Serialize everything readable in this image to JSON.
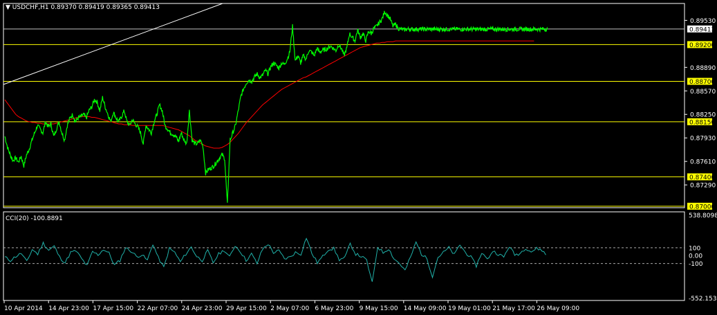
{
  "colors": {
    "background": "#000000",
    "frame": "#ffffff",
    "price": "#00ff00",
    "ma": "#ff0000",
    "level": "#ffff00",
    "level_label_bg": "#ffff00",
    "current_line": "#c0c0c0",
    "cci": "#20b2aa",
    "trendline": "#ffffff"
  },
  "main_panel": {
    "title": "USDCHF,H1  0.89370 0.89419 0.89365 0.89413"
  },
  "cci_panel": {
    "title": "CCI(20) -100.8891"
  },
  "chart_data": [
    {
      "type": "line",
      "symbol": "USDCHF",
      "timeframe": "H1",
      "ohlc_last": {
        "open": 0.8937,
        "high": 0.89419,
        "low": 0.89365,
        "close": 0.89413
      },
      "current_price": "0.89413",
      "y_ticks": [
        "0.89530",
        "0.88890",
        "0.88570",
        "0.88250",
        "0.87930",
        "0.87610",
        "0.87290"
      ],
      "ylim": [
        0.8698,
        0.8976
      ],
      "horizontal_levels": [
        "0.89200",
        "0.88700",
        "0.88150",
        "0.87400",
        "0.87000"
      ],
      "x_tick_labels": [
        "10 Apr 2014",
        "14 Apr 23:00",
        "17 Apr 15:00",
        "22 Apr 07:00",
        "24 Apr 23:00",
        "29 Apr 15:00",
        "2 May 07:00",
        "6 May 23:00",
        "9 May 15:00",
        "14 May 09:00",
        "19 May 01:00",
        "21 May 17:00",
        "26 May 09:00"
      ],
      "series": [
        {
          "x": [
            0,
            0.5,
            1,
            1.5,
            2,
            2.5,
            3,
            3.5,
            4,
            4.5,
            5,
            5.5,
            6,
            6.5,
            7,
            7.5,
            8,
            8.5,
            9,
            9.5,
            10,
            10.5,
            11,
            11.5,
            12,
            12.5,
            13,
            13.5,
            14,
            14.5,
            15,
            15.5,
            16,
            16.5,
            17,
            17.5,
            18,
            18.5,
            19,
            19.5,
            20,
            20.5,
            21,
            21.5,
            22,
            22.5,
            23,
            23.5,
            24,
            24.5,
            25,
            25.5,
            26,
            26.5,
            27,
            27.5,
            28,
            28.5,
            29,
            29.5,
            30,
            30.5,
            31,
            31.5,
            32,
            32.5,
            33,
            33.5,
            34,
            34.5,
            35,
            35.5,
            36,
            36.5,
            37,
            37.5,
            38,
            38.5,
            39,
            39.5,
            40,
            40.5,
            41,
            41.5,
            42,
            42.5,
            43,
            43.5,
            44,
            44.5,
            45,
            45.5,
            46,
            46.5,
            47,
            47.5,
            48,
            48.5,
            49,
            49.5,
            50,
            50.5,
            51,
            51.5,
            52,
            52.5,
            53,
            53.5,
            54,
            54.5,
            55,
            55.5,
            56,
            56.5,
            57,
            57.5,
            58,
            58.5,
            59,
            59.5,
            60,
            60.5,
            61,
            61.5,
            62,
            62.5,
            63,
            63.5,
            64,
            64.5,
            65,
            65.5,
            66,
            66.5,
            67,
            67.5,
            68,
            68.5,
            69,
            69.5,
            70,
            70.5,
            71,
            71.5,
            72,
            72.5,
            73,
            73.5,
            74,
            74.5,
            75,
            75.5,
            76,
            76.5,
            77,
            77.5,
            78,
            78.5,
            79,
            79.5,
            80,
            80.5,
            81,
            81.5,
            82,
            82.5,
            83,
            83.5,
            84,
            84.5,
            85,
            85.5,
            86,
            86.5,
            87,
            87.5,
            88,
            88.5,
            89,
            89.5,
            90,
            90.5,
            91,
            91.5,
            92,
            92.5,
            93,
            93.5,
            94,
            94.5,
            95,
            95.5,
            96,
            96.5,
            97,
            97.5,
            98,
            98.5,
            99,
            99.5,
            100
          ],
          "name": "",
          "values": [
            0.8795,
            0.878,
            0.877,
            0.8762,
            0.8766,
            0.876,
            0.8768,
            0.8755,
            0.877,
            0.8778,
            0.879,
            0.88,
            0.881,
            0.8805,
            0.88,
            0.8815,
            0.8808,
            0.8812,
            0.8795,
            0.8805,
            0.8815,
            0.88,
            0.879,
            0.881,
            0.882,
            0.8825,
            0.8815,
            0.882,
            0.8822,
            0.8825,
            0.882,
            0.883,
            0.8835,
            0.8845,
            0.8842,
            0.883,
            0.8848,
            0.8835,
            0.8825,
            0.8815,
            0.8828,
            0.882,
            0.8815,
            0.8822,
            0.883,
            0.8815,
            0.881,
            0.8818,
            0.8812,
            0.8808,
            0.88,
            0.8785,
            0.881,
            0.8805,
            0.88,
            0.8815,
            0.8825,
            0.8838,
            0.883,
            0.881,
            0.8805,
            0.88,
            0.8798,
            0.8795,
            0.8788,
            0.88,
            0.879,
            0.8785,
            0.883,
            0.879,
            0.8785,
            0.8785,
            0.879,
            0.8782,
            0.8745,
            0.875,
            0.8752,
            0.8755,
            0.876,
            0.8765,
            0.877,
            0.8765,
            0.8702,
            0.879,
            0.88,
            0.881,
            0.883,
            0.885,
            0.886,
            0.8868,
            0.8872,
            0.887,
            0.8876,
            0.888,
            0.8875,
            0.8878,
            0.8885,
            0.888,
            0.889,
            0.8895,
            0.8892,
            0.8888,
            0.8895,
            0.8893,
            0.89,
            0.891,
            0.8945,
            0.8898,
            0.8905,
            0.8895,
            0.8905,
            0.89,
            0.8912,
            0.891,
            0.8905,
            0.8915,
            0.891,
            0.8912,
            0.8913,
            0.8915,
            0.8918,
            0.8915,
            0.8912,
            0.892,
            0.8915,
            0.8905,
            0.8915,
            0.8935,
            0.893,
            0.8925,
            0.894,
            0.893,
            0.8935,
            0.8925,
            0.8938,
            0.8935,
            0.8942,
            0.8945,
            0.895,
            0.8955,
            0.8965,
            0.896,
            0.8955,
            0.8945,
            0.8948,
            0.8942,
            0.8941,
            0.894,
            0.8941,
            0.8941,
            0.8941,
            0.8941,
            0.8941,
            0.8941,
            0.8941,
            0.8941,
            0.8941,
            0.8941,
            0.8941,
            0.8941,
            0.8941,
            0.8941,
            0.8941,
            0.8941,
            0.8941,
            0.8941,
            0.8941,
            0.8941,
            0.8941,
            0.8941,
            0.8941,
            0.8941,
            0.8941,
            0.8941,
            0.8941,
            0.8941,
            0.8941,
            0.8941,
            0.8941,
            0.8941,
            0.8941,
            0.8941,
            0.8941,
            0.8941,
            0.8941,
            0.8941,
            0.8941,
            0.8941,
            0.8941,
            0.8941,
            0.8941,
            0.8941,
            0.8941,
            0.8941,
            0.8941,
            0.8941,
            0.8941,
            0.8941,
            0.8941,
            0.8941,
            0.8941
          ]
        },
        {
          "name": "",
          "ma_values": [
            0.8845,
            0.884,
            0.8835,
            0.883,
            0.8825,
            0.8822,
            0.882,
            0.8818,
            0.8816,
            0.8815,
            0.8814,
            0.8814,
            0.8813,
            0.8813,
            0.8812,
            0.8812,
            0.8812,
            0.8812,
            0.8812,
            0.8813,
            0.8814,
            0.8815,
            0.8816,
            0.8817,
            0.8818,
            0.8819,
            0.882,
            0.8821,
            0.8822,
            0.8822,
            0.8822,
            0.8822,
            0.8821,
            0.8821,
            0.882,
            0.8819,
            0.8818,
            0.8817,
            0.8816,
            0.8815,
            0.8814,
            0.8813,
            0.8812,
            0.8812,
            0.8811,
            0.8811,
            0.8811,
            0.881,
            0.881,
            0.881,
            0.881,
            0.881,
            0.881,
            0.881,
            0.881,
            0.881,
            0.881,
            0.881,
            0.881,
            0.8809,
            0.8808,
            0.8807,
            0.8806,
            0.8805,
            0.8804,
            0.8802,
            0.88,
            0.8798,
            0.8796,
            0.8793,
            0.879,
            0.8788,
            0.8786,
            0.8784,
            0.8782,
            0.8781,
            0.878,
            0.8779,
            0.8779,
            0.8779,
            0.878,
            0.8782,
            0.8784,
            0.8787,
            0.8791,
            0.8795,
            0.8799,
            0.8804,
            0.8809,
            0.8814,
            0.8818,
            0.8822,
            0.8826,
            0.883,
            0.8834,
            0.8838,
            0.8841,
            0.8844,
            0.8847,
            0.885,
            0.8853,
            0.8856,
            0.8859,
            0.8861,
            0.8863,
            0.8865,
            0.8867,
            0.8869,
            0.8871,
            0.8873,
            0.8875,
            0.8876,
            0.8878,
            0.888,
            0.8882,
            0.8884,
            0.8886,
            0.8888,
            0.889,
            0.8892,
            0.8894,
            0.8896,
            0.8898,
            0.89,
            0.8902,
            0.8904,
            0.8906,
            0.8908,
            0.891,
            0.8912,
            0.8914,
            0.8916,
            0.8917,
            0.8918,
            0.8919,
            0.892,
            0.8921,
            0.8922,
            0.8922,
            0.8923,
            0.8923,
            0.8924,
            0.8924,
            0.8924,
            0.8925,
            0.8925,
            0.8925,
            0.8925,
            0.8925,
            0.8925,
            0.8925,
            0.8925,
            0.8925,
            0.8925,
            0.8925,
            0.8925,
            0.8925,
            0.8925,
            0.8925,
            0.8925,
            0.8925,
            0.8925,
            0.8925,
            0.8925,
            0.8925,
            0.8925,
            0.8925,
            0.8925,
            0.8925,
            0.8925,
            0.8925,
            0.8925,
            0.8925,
            0.8925,
            0.8925,
            0.8925,
            0.8925,
            0.8925,
            0.8925,
            0.8925,
            0.8925,
            0.8925,
            0.8925,
            0.8925,
            0.8925,
            0.8925,
            0.8925,
            0.8925,
            0.8925,
            0.8925,
            0.8925,
            0.8925,
            0.8925,
            0.8925,
            0.8925,
            0.8925
          ]
        }
      ]
    },
    {
      "type": "line",
      "indicator": "CCI(20)",
      "current_value": "-100.8891",
      "y_ticks": [
        "538.8098",
        "100",
        "0.00",
        "-100",
        "-552.1533"
      ],
      "ylim": [
        -552.1533,
        538.8098
      ],
      "levels": [
        100,
        -100
      ],
      "series": [
        {
          "name": "",
          "values": [
            -20,
            -60,
            -10,
            30,
            -80,
            80,
            20,
            160,
            70,
            120,
            -20,
            -90,
            40,
            60,
            -40,
            -130,
            50,
            10,
            80,
            30,
            -120,
            -60,
            100,
            60,
            -10,
            10,
            -60,
            150,
            -30,
            -150,
            90,
            40,
            -80,
            20,
            110,
            -10,
            -60,
            60,
            -90,
            20,
            70,
            -20,
            130,
            50,
            -60,
            20,
            -100,
            80,
            150,
            40,
            60,
            -40,
            -20,
            40,
            20,
            230,
            30,
            -90,
            -10,
            80,
            90,
            -50,
            -30,
            150,
            20,
            -10,
            -60,
            -350,
            110,
            40,
            90,
            -40,
            -100,
            -190,
            -20,
            170,
            20,
            -40,
            -260,
            -20,
            40,
            100,
            10,
            140,
            40,
            -20,
            -130,
            40,
            -50,
            60,
            20,
            -20,
            120,
            10,
            30,
            100,
            50,
            90,
            70,
            -20
          ]
        }
      ]
    }
  ]
}
